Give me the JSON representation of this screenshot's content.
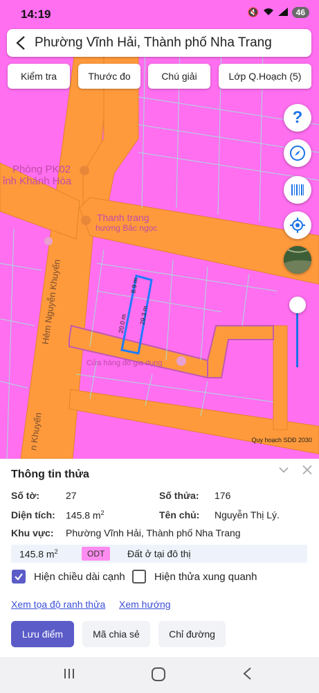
{
  "status_bar": {
    "time": "14:19",
    "battery": "46"
  },
  "header": {
    "title": "Phường Vĩnh Hải, Thành phố Nha Trang"
  },
  "toolbar": {
    "check_label": "Kiểm tra",
    "measure_label": "Thước đo",
    "legend_label": "Chú giải",
    "layers_label": "Lớp Q.Hoạch (5)"
  },
  "map": {
    "credit": "Quy hoạch SDĐ 2030",
    "poi_1": "Phòng PK02",
    "poi_1b": "ỉnh Khánh Hòa",
    "poi_2a": "Thanh trang",
    "poi_2b": "hương Bắc ngọc",
    "poi_3": "Cửa hàng đồ gia dụng",
    "street_1": "Hẻm Nguyễn Khuyến",
    "street_2": "n Khuyến",
    "edge_top": "8.9 m",
    "edge_left": "20.0 m",
    "edge_right": "29.3 m",
    "fill_color": "#ff6ff0",
    "road_color": "#ff9a3c",
    "parcel_outline_color": "#1e7bff"
  },
  "panel": {
    "title": "Thông tin thửa",
    "sheet_label": "Số tờ:",
    "sheet_value": "27",
    "parcel_label": "Số thửa:",
    "parcel_value": "176",
    "area_label": "Diện tích:",
    "area_value": "145.8 m",
    "area_sup": "2",
    "owner_label": "Tên chủ:",
    "owner_value": "Nguyễn Thị Lý.",
    "region_label": "Khu vực:",
    "region_value": "Phường Vĩnh Hải, Thành phố Nha Trang",
    "landuse": {
      "area": "145.8 m",
      "area_sup": "2",
      "code": "ODT",
      "description": "Đất ở tại đô thị"
    },
    "checkbox_edges": "Hiện chiều dài cạnh",
    "checkbox_edges_checked": true,
    "checkbox_neighbors": "Hiện thửa xung quanh",
    "checkbox_neighbors_checked": false,
    "link_coords": "Xem tọa độ ranh thửa",
    "link_direction": "Xem hướng",
    "btn_save": "Lưu điểm",
    "btn_share": "Mã chia sẻ",
    "btn_directions": "Chỉ đường"
  }
}
